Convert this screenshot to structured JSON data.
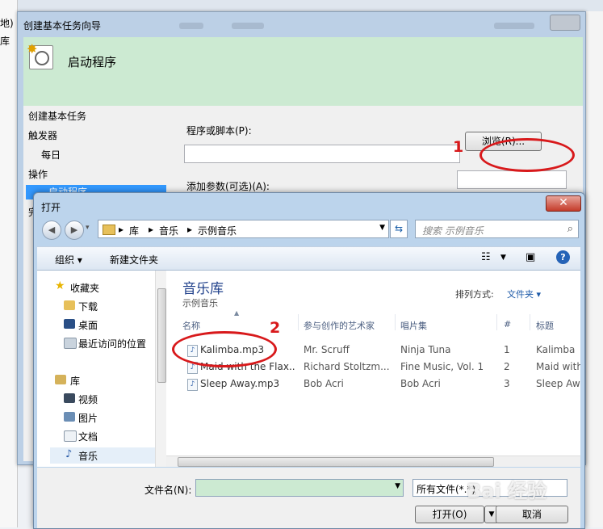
{
  "background": {
    "left_strip": [
      "地)",
      "库"
    ],
    "wizard": {
      "title": "创建基本任务向导",
      "heading": "启动程序",
      "nav": {
        "create_task": "创建基本任务",
        "trigger": "触发器",
        "daily": "每日",
        "action": "操作",
        "start_program": "启动程序",
        "finish": "完"
      },
      "program_label": "程序或脚本(P):",
      "program_value": "",
      "browse_button": "浏览(R)...",
      "args_label": "添加参数(可选)(A):",
      "args_value": ""
    }
  },
  "annotations": {
    "one": "1",
    "two": "2"
  },
  "dialog": {
    "title": "打开",
    "close": "✕",
    "address": {
      "segments": [
        "库",
        "音乐",
        "示例音乐"
      ]
    },
    "search_placeholder": "搜索 示例音乐",
    "toolbar": {
      "organize": "组织 ▾",
      "new_folder": "新建文件夹"
    },
    "sidebar": {
      "favorites": "收藏夹",
      "downloads": "下载",
      "desktop": "桌面",
      "recent": "最近访问的位置",
      "libraries": "库",
      "videos": "视频",
      "pictures": "图片",
      "documents": "文档",
      "music": "音乐"
    },
    "library": {
      "title": "音乐库",
      "subtitle": "示例音乐",
      "sort_label": "排列方式:",
      "sort_value": "文件夹 ▾"
    },
    "columns": [
      "名称",
      "参与创作的艺术家",
      "唱片集",
      "#",
      "标题"
    ],
    "files": [
      {
        "name": "Kalimba.mp3",
        "artist": "Mr. Scruff",
        "album": "Ninja Tuna",
        "num": "1",
        "title": "Kalimba"
      },
      {
        "name": "Maid with the Flax...",
        "artist": "Richard Stoltzm...",
        "album": "Fine Music, Vol. 1",
        "num": "2",
        "title": "Maid with"
      },
      {
        "name": "Sleep Away.mp3",
        "artist": "Bob Acri",
        "album": "Bob Acri",
        "num": "3",
        "title": "Sleep Aw"
      }
    ],
    "filename_label": "文件名(N):",
    "filename_value": "",
    "filter": "所有文件(*.*)",
    "open_button": "打开(O)",
    "cancel_button": "取消"
  },
  "watermark": "Bai 经验",
  "colors": {
    "accent_red": "#d8191b",
    "banner_green": "#ccead2",
    "selection_blue": "#3399ff"
  }
}
